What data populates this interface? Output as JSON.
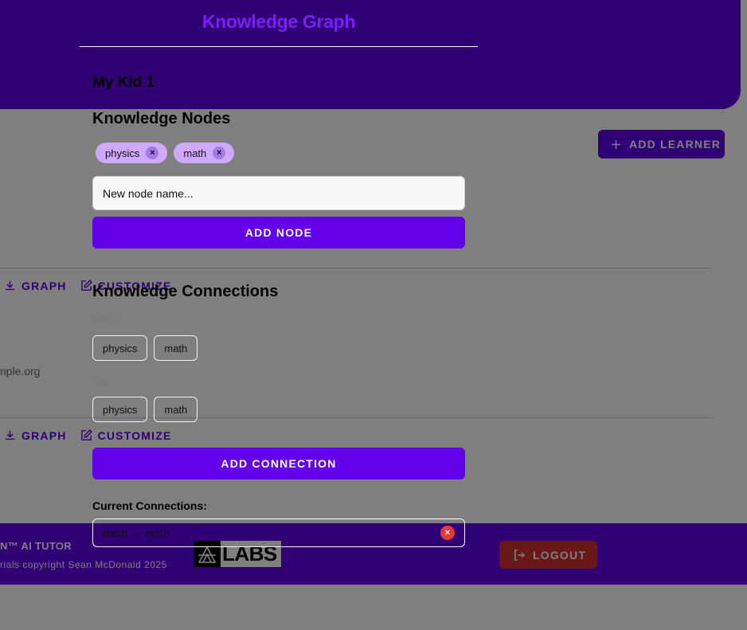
{
  "background": {
    "add_learner_label": "ADD LEARNER",
    "actions_row_1": {
      "graph_label": "GRAPH",
      "customize_label": "CUSTOMIZE"
    },
    "actions_row_2": {
      "graph_label": "GRAPH",
      "customize_label": "CUSTOMIZE"
    },
    "learner_email_fragment": "mple.org",
    "footer": {
      "brand_fragment": "N™ AI TUTOR",
      "copyright_fragment": "rials copyright Sean McDonald 2025",
      "logo_text": "LABS",
      "logout_label": "LOGOUT"
    }
  },
  "dialog": {
    "title": "Knowledge Graph",
    "learner_name": "My Kid 1",
    "nodes": {
      "heading": "Knowledge Nodes",
      "chips": [
        {
          "label": "physics"
        },
        {
          "label": "math"
        }
      ],
      "chip_remove_glyph": "×",
      "input_placeholder": "New node name...",
      "add_button_label": "ADD NODE"
    },
    "connections": {
      "heading": "Knowledge Connections",
      "from_label": "From:",
      "from_options": [
        "physics",
        "math"
      ],
      "to_label": "To:",
      "to_options": [
        "physics",
        "math"
      ],
      "add_button_label": "ADD CONNECTION",
      "current_label": "Current Connections:",
      "items": [
        {
          "text": "math → math",
          "remove_glyph": "×"
        }
      ]
    }
  },
  "colors": {
    "primary": "#6200ea",
    "title": "#7c1fff",
    "chip": "#d0a8ff",
    "danger": "#d32f2f",
    "overlay": "rgba(0,0,0,0.5)"
  },
  "icons": {
    "add_learner": "plus-icon",
    "graph": "download-icon",
    "customize": "edit-icon",
    "logout": "logout-icon",
    "chip_remove": "close-icon",
    "connection_remove": "close-circle-icon"
  }
}
